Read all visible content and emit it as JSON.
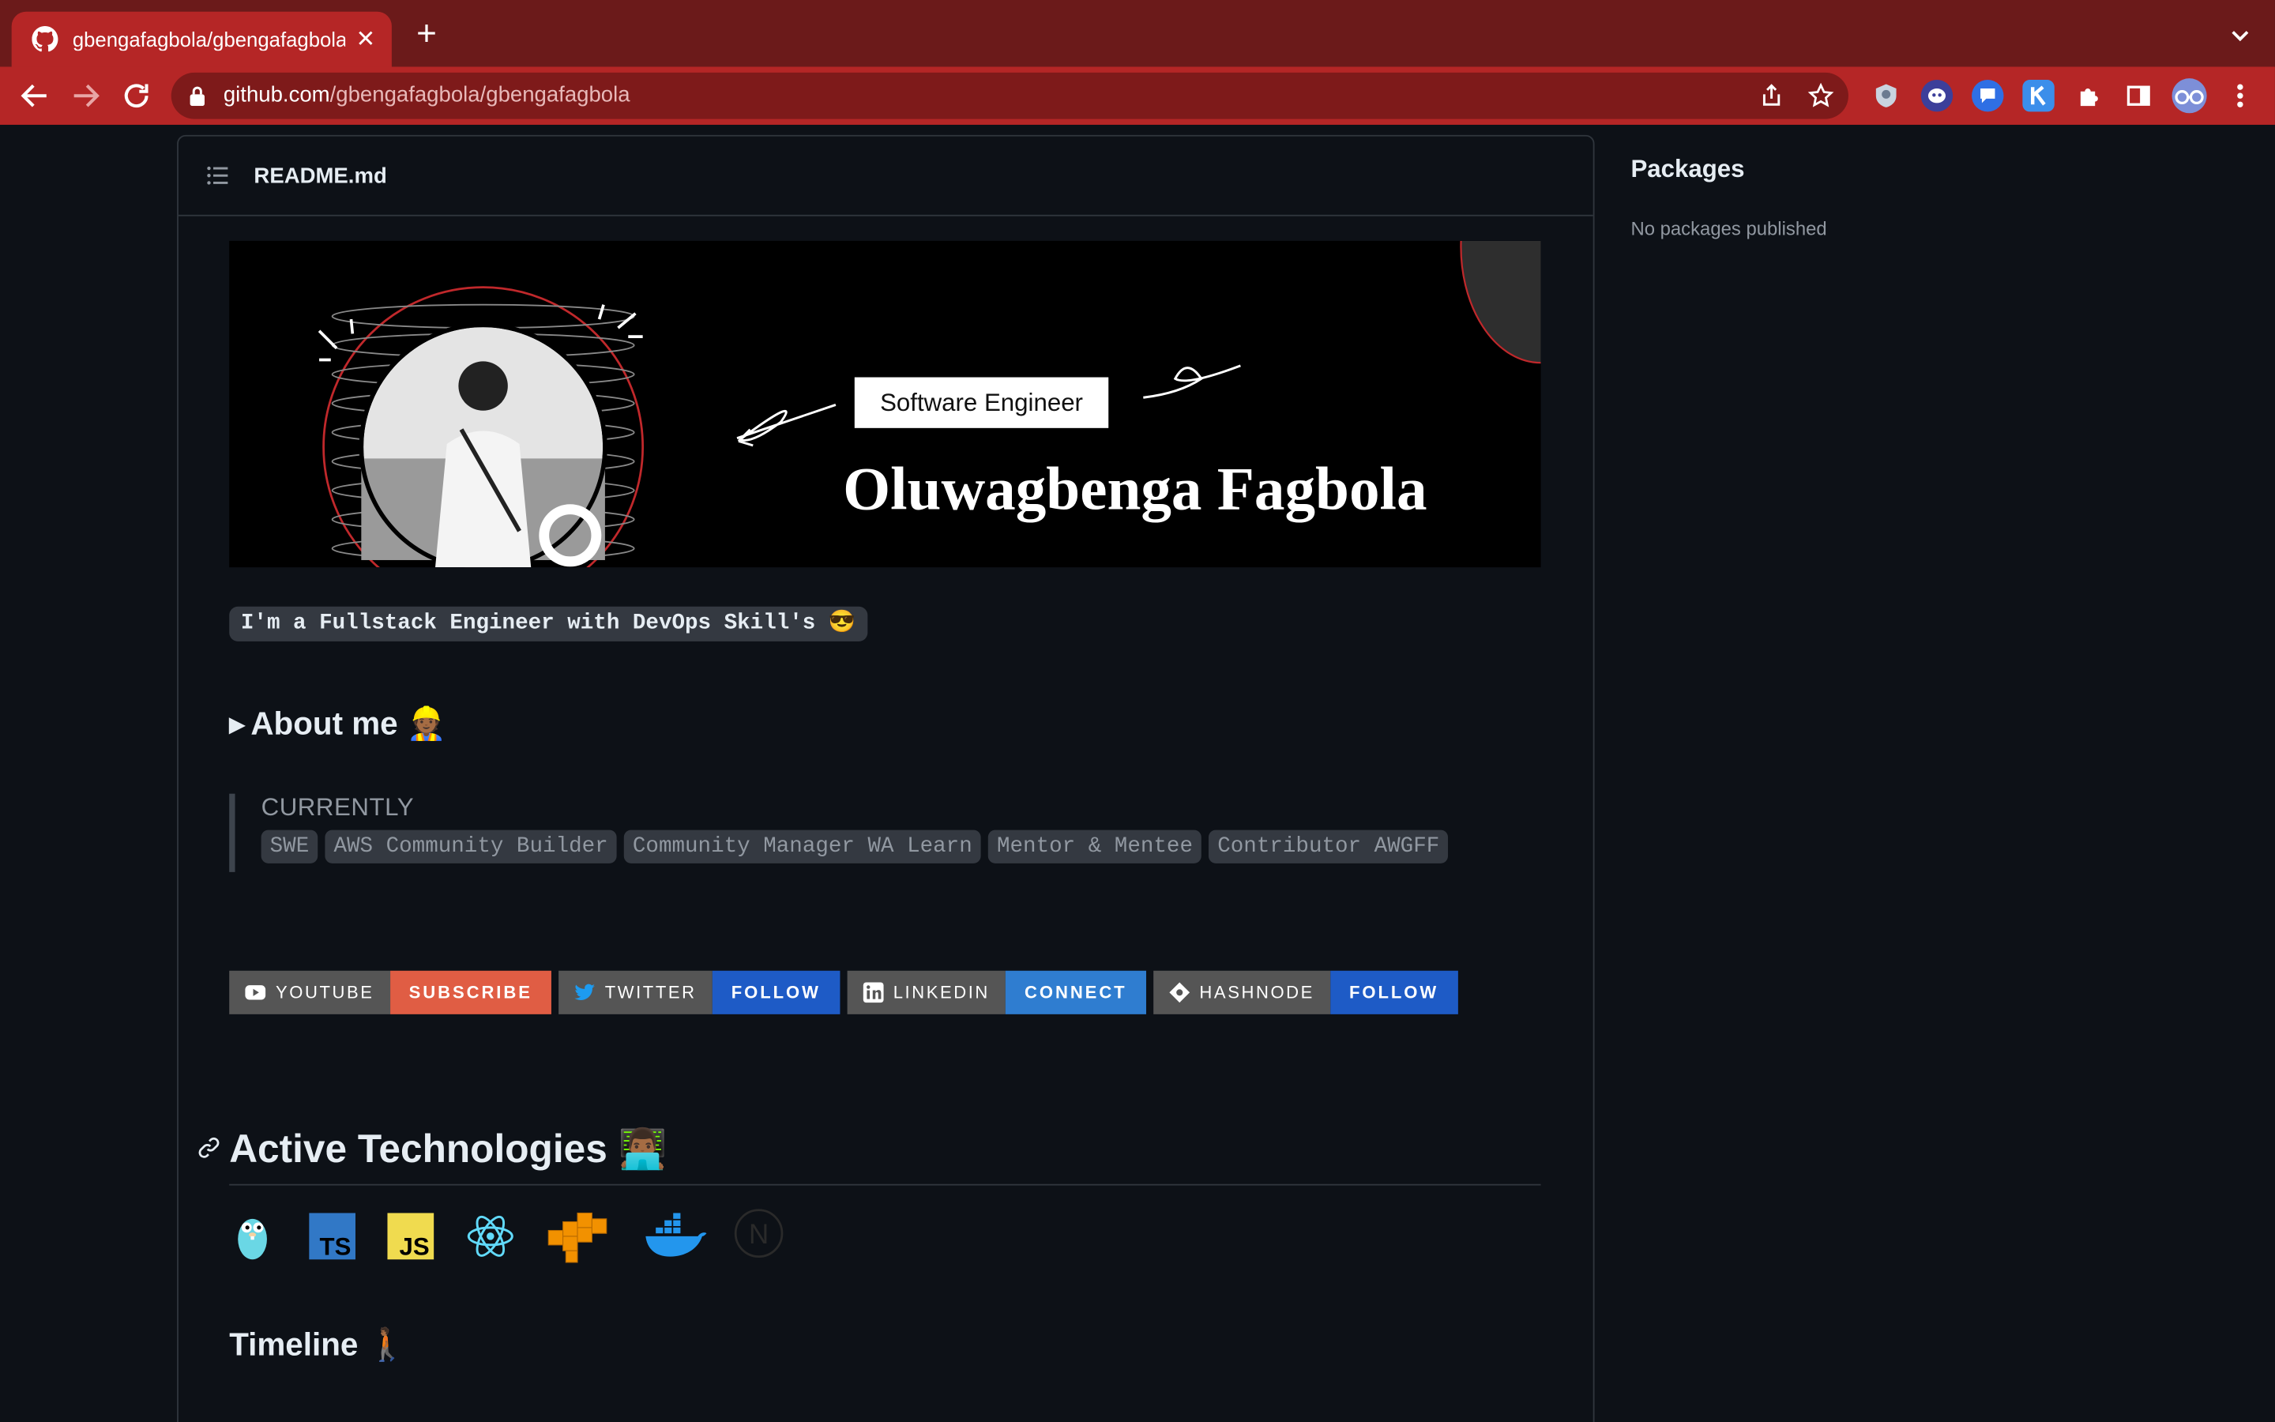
{
  "browser": {
    "tab_title": "gbengafagbola/gbengafagbola",
    "close_glyph": "✕",
    "newtab_glyph": "+",
    "url_host": "github.com",
    "url_path": "/gbengafagbola/gbengafagbola",
    "icons": [
      "back-arrow",
      "forward-arrow",
      "reload",
      "lock",
      "share",
      "star",
      "shield-extension",
      "ghost-extension",
      "chat-extension",
      "k-extension",
      "puzzle-extension",
      "side-panel",
      "profile-avatar",
      "kebab-menu",
      "tab-list-chevron"
    ],
    "colors": {
      "tabstrip": "#6b1a1a",
      "toolbar": "#b52626",
      "omnibox": "#7e1a1a"
    }
  },
  "readme": {
    "filename": "README.md",
    "banner": {
      "role": "Software Engineer",
      "name": "Oluwagbenga Fagbola"
    },
    "tagline": "I'm a Fullstack Engineer with DevOps Skill's 😎",
    "about": "About me 👷🏾",
    "about_marker": "▶",
    "currently": {
      "label": "CURRENTLY",
      "items": [
        "SWE",
        "AWS Community Builder",
        "Community Manager WA Learn",
        "Mentor & Mentee",
        "Contributor AWGFF"
      ]
    },
    "badges": [
      {
        "label": "YOUTUBE",
        "action": "SUBSCRIBE",
        "color": "#e05d44",
        "icon": "youtube-icon"
      },
      {
        "label": "TWITTER",
        "action": "FOLLOW",
        "color": "#1e5bc6",
        "icon": "twitter-icon"
      },
      {
        "label": "LINKEDIN",
        "action": "CONNECT",
        "color": "#2f7dd0",
        "icon": "linkedin-icon"
      },
      {
        "label": "HASHNODE",
        "action": "FOLLOW",
        "color": "#1e5bc6",
        "icon": "hashnode-icon"
      }
    ],
    "active_tech_heading": "Active Technologies 👨🏾‍💻",
    "tech_icons": [
      "go-gopher-icon",
      "typescript-icon",
      "javascript-icon",
      "react-icon",
      "aws-icon",
      "docker-icon",
      "nextjs-icon"
    ],
    "typescript_glyph": "TS",
    "javascript_glyph": "JS",
    "nextjs_glyph": "N",
    "timeline_heading": "Timeline 🚶🏾"
  },
  "sidebar": {
    "packages_heading": "Packages",
    "packages_empty": "No packages published"
  }
}
